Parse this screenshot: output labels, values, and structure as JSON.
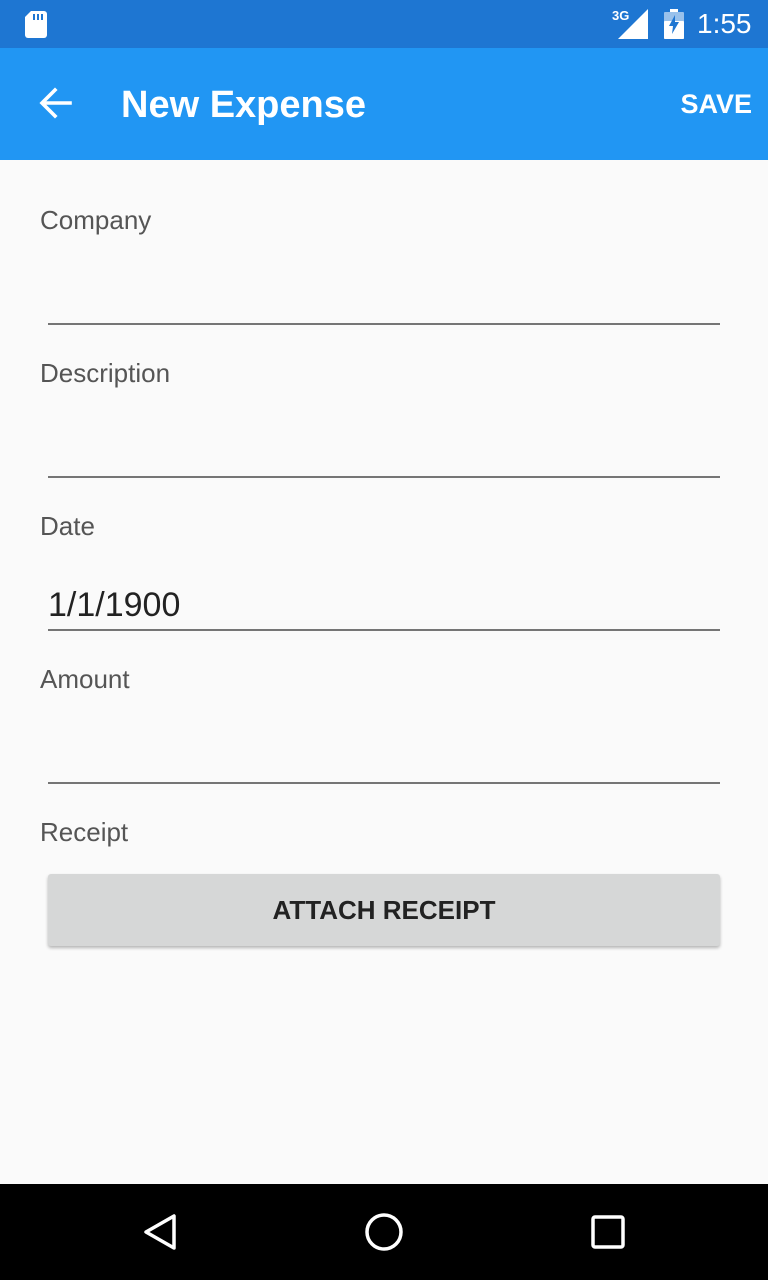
{
  "status_bar": {
    "network_type": "3G",
    "time": "1:55",
    "icons": [
      "sd-card-icon",
      "signal-icon",
      "battery-charging-icon"
    ]
  },
  "app_bar": {
    "back_icon": "arrow-back-icon",
    "title": "New Expense",
    "save_label": "SAVE",
    "color": "#2196f3"
  },
  "form": {
    "company": {
      "label": "Company",
      "value": ""
    },
    "description": {
      "label": "Description",
      "value": ""
    },
    "date": {
      "label": "Date",
      "value": "1/1/1900"
    },
    "amount": {
      "label": "Amount",
      "value": ""
    },
    "receipt": {
      "label": "Receipt",
      "button_label": "ATTACH RECEIPT"
    }
  },
  "nav_bar": {
    "buttons": [
      "back-triangle-icon",
      "home-circle-icon",
      "recents-square-icon"
    ]
  }
}
